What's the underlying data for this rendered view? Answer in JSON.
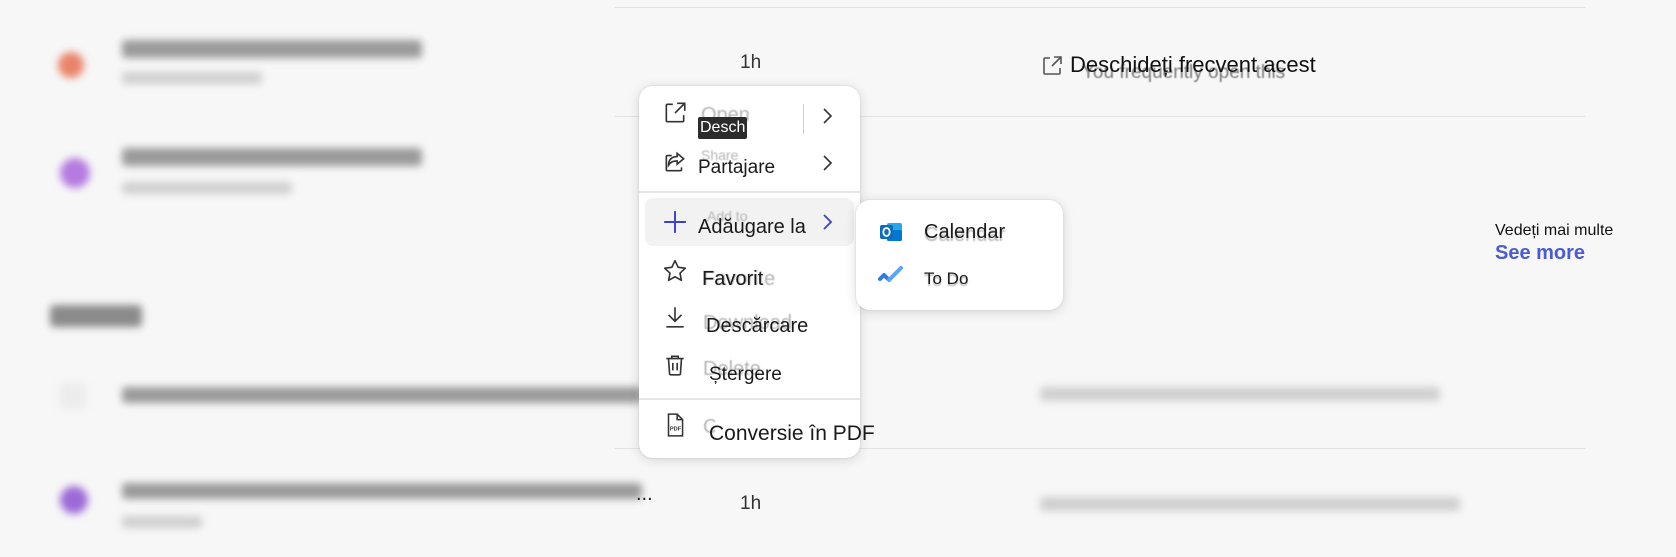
{
  "background": {
    "rows": [
      {
        "time": "1h",
        "reason_ghost": "You frequently open this",
        "reason": "Deschideți frecvent acest"
      },
      {
        "time": "1h"
      }
    ],
    "see_more_caption": "Vedeți mai multe",
    "see_more": "See more",
    "row_ellipsis": "..."
  },
  "context_menu": {
    "open": {
      "ghost": "Open",
      "label": "Desch",
      "icon": "open-in-new-icon"
    },
    "share": {
      "ghost": "Share",
      "label": "Partajare",
      "icon": "share-icon"
    },
    "add_to": {
      "ghost": "Add to",
      "label": "Adăugare la",
      "icon": "plus-icon"
    },
    "favorite": {
      "ghost": "Favorite",
      "label": "Favorit",
      "icon": "star-icon"
    },
    "download": {
      "ghost": "Download",
      "label": "Descărcare",
      "icon": "download-icon"
    },
    "delete": {
      "ghost": "Delete",
      "label": "Ștergere",
      "icon": "trash-icon"
    },
    "convert": {
      "ghost": "Convert to PDF",
      "label": "Conversie în PDF",
      "icon": "pdf-icon"
    }
  },
  "submenu": {
    "calendar": {
      "ghost": "Calendar",
      "label": "Calendar",
      "icon": "outlook-icon"
    },
    "todo": {
      "ghost": "To Do",
      "label": "To Do",
      "icon": "todo-check-icon"
    }
  },
  "colors": {
    "accent": "#4a5bd4",
    "outlook_blue": "#0f6cbd",
    "todo_blue": "#2f7de1",
    "plus_blue": "#3a43c4"
  }
}
